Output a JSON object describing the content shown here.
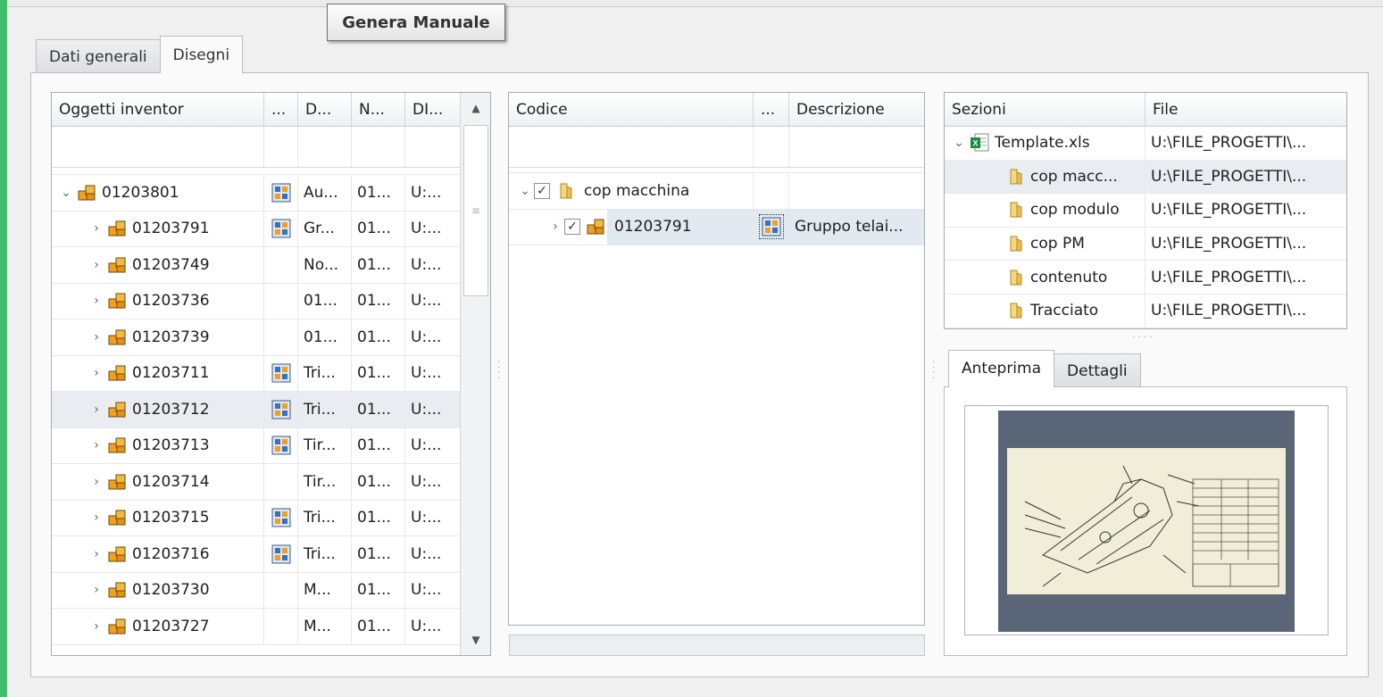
{
  "tooltip": "Genera Manuale",
  "tabs": [
    {
      "label": "Dati generali",
      "active": false
    },
    {
      "label": "Disegni",
      "active": true
    }
  ],
  "inventor_grid": {
    "columns": [
      "Oggetti inventor",
      "...",
      "D...",
      "N...",
      "DI..."
    ],
    "rows": [
      {
        "code": "01203801",
        "expander": "⌄",
        "has_drawing": true,
        "d": "Au...",
        "n": "01...",
        "di": "U:...",
        "indent": 0,
        "selected": false
      },
      {
        "code": "01203791",
        "expander": "›",
        "has_drawing": true,
        "d": "Gr...",
        "n": "01...",
        "di": "U:...",
        "indent": 1,
        "selected": false
      },
      {
        "code": "01203749",
        "expander": "›",
        "has_drawing": false,
        "d": "No...",
        "n": "01...",
        "di": "U:...",
        "indent": 1,
        "selected": false
      },
      {
        "code": "01203736",
        "expander": "›",
        "has_drawing": false,
        "d": "01...",
        "n": "01...",
        "di": "U:...",
        "indent": 1,
        "selected": false
      },
      {
        "code": "01203739",
        "expander": "›",
        "has_drawing": false,
        "d": "01...",
        "n": "01...",
        "di": "U:...",
        "indent": 1,
        "selected": false
      },
      {
        "code": "01203711",
        "expander": "›",
        "has_drawing": true,
        "d": "Tri...",
        "n": "01...",
        "di": "U:...",
        "indent": 1,
        "selected": false
      },
      {
        "code": "01203712",
        "expander": "›",
        "has_drawing": true,
        "d": "Tri...",
        "n": "01...",
        "di": "U:...",
        "indent": 1,
        "selected": true
      },
      {
        "code": "01203713",
        "expander": "›",
        "has_drawing": true,
        "d": "Tir...",
        "n": "01...",
        "di": "U:...",
        "indent": 1,
        "selected": false
      },
      {
        "code": "01203714",
        "expander": "›",
        "has_drawing": false,
        "d": "Tir...",
        "n": "01...",
        "di": "U:...",
        "indent": 1,
        "selected": false
      },
      {
        "code": "01203715",
        "expander": "›",
        "has_drawing": true,
        "d": "Tri...",
        "n": "01...",
        "di": "U:...",
        "indent": 1,
        "selected": false
      },
      {
        "code": "01203716",
        "expander": "›",
        "has_drawing": true,
        "d": "Tri...",
        "n": "01...",
        "di": "U:...",
        "indent": 1,
        "selected": false
      },
      {
        "code": "01203730",
        "expander": "›",
        "has_drawing": false,
        "d": "M...",
        "n": "01...",
        "di": "U:...",
        "indent": 1,
        "selected": false
      },
      {
        "code": "01203727",
        "expander": "›",
        "has_drawing": false,
        "d": "M...",
        "n": "01...",
        "di": "U:...",
        "indent": 1,
        "selected": false
      }
    ]
  },
  "codice_grid": {
    "columns": [
      "Codice",
      "...",
      "Descrizione"
    ],
    "rows": [
      {
        "label": "cop macchina",
        "expander": "⌄",
        "checked": true,
        "icon": "folder-icon",
        "description": "",
        "indent": 0,
        "selected": false
      },
      {
        "label": "01203791",
        "expander": "›",
        "checked": true,
        "icon": "assembly-icon",
        "description": "Gruppo telai...",
        "indent": 1,
        "selected": true
      }
    ]
  },
  "sezioni_grid": {
    "columns": [
      "Sezioni",
      "File"
    ],
    "rows": [
      {
        "label": "Template.xls",
        "file": "U:\\FILE_PROGETTI\\...",
        "expander": "⌄",
        "icon": "excel-icon",
        "indent": 0,
        "selected": false
      },
      {
        "label": "cop macc...",
        "file": "U:\\FILE_PROGETTI\\...",
        "expander": "",
        "icon": "folder-icon",
        "indent": 1,
        "selected": true
      },
      {
        "label": "cop modulo",
        "file": "U:\\FILE_PROGETTI\\...",
        "expander": "",
        "icon": "folder-icon",
        "indent": 1,
        "selected": false
      },
      {
        "label": "cop PM",
        "file": "U:\\FILE_PROGETTI\\...",
        "expander": "",
        "icon": "folder-icon",
        "indent": 1,
        "selected": false
      },
      {
        "label": "contenuto",
        "file": "U:\\FILE_PROGETTI\\...",
        "expander": "",
        "icon": "folder-icon",
        "indent": 1,
        "selected": false
      },
      {
        "label": "Tracciato",
        "file": "U:\\FILE_PROGETTI\\...",
        "expander": "",
        "icon": "folder-icon",
        "indent": 1,
        "selected": false
      }
    ]
  },
  "preview_tabs": [
    {
      "label": "Anteprima",
      "active": true
    },
    {
      "label": "Dettagli",
      "active": false
    }
  ],
  "icons": {
    "assembly": "assembly-icon",
    "drawing": "drawing-icon",
    "folder": "folder-icon",
    "excel": "excel-icon",
    "scroll_up": "scroll-up-icon",
    "scroll_down": "scroll-down-icon"
  },
  "colors": {
    "accent_green": "#3fbf6a",
    "selection": "#e9edf1",
    "assembly_orange": "#f0a020",
    "preview_bg": "#5a6577"
  }
}
